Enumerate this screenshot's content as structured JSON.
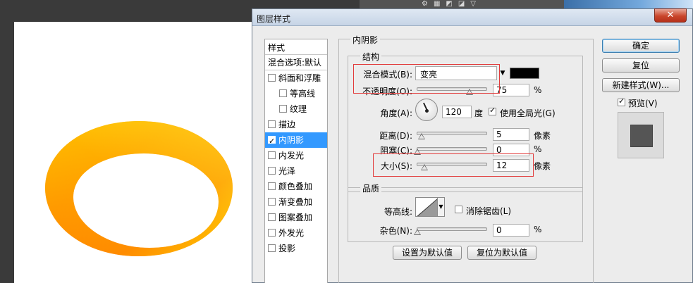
{
  "dialog": {
    "title": "图层样式",
    "close_glyph": "✕"
  },
  "styles_panel": {
    "header": "样式",
    "blend_options": "混合选项:默认",
    "items": [
      {
        "label": "斜面和浮雕",
        "checked": false,
        "indent": false,
        "selected": false
      },
      {
        "label": "等高线",
        "checked": false,
        "indent": true,
        "selected": false
      },
      {
        "label": "纹理",
        "checked": false,
        "indent": true,
        "selected": false
      },
      {
        "label": "描边",
        "checked": false,
        "indent": false,
        "selected": false
      },
      {
        "label": "内阴影",
        "checked": true,
        "indent": false,
        "selected": true
      },
      {
        "label": "内发光",
        "checked": false,
        "indent": false,
        "selected": false
      },
      {
        "label": "光泽",
        "checked": false,
        "indent": false,
        "selected": false
      },
      {
        "label": "颜色叠加",
        "checked": false,
        "indent": false,
        "selected": false
      },
      {
        "label": "渐变叠加",
        "checked": false,
        "indent": false,
        "selected": false
      },
      {
        "label": "图案叠加",
        "checked": false,
        "indent": false,
        "selected": false
      },
      {
        "label": "外发光",
        "checked": false,
        "indent": false,
        "selected": false
      },
      {
        "label": "投影",
        "checked": false,
        "indent": false,
        "selected": false
      }
    ]
  },
  "inner_shadow": {
    "section_title": "内阴影",
    "structure": {
      "title": "结构",
      "blend_mode_label": "混合模式(B):",
      "blend_mode_value": "变亮",
      "color": "#000000",
      "opacity_label": "不透明度(O):",
      "opacity_value": "75",
      "opacity_unit": "%",
      "opacity_fraction": 0.75,
      "angle_label": "角度(A):",
      "angle_value": "120",
      "angle_unit": "度",
      "global_light_label": "使用全局光(G)",
      "global_light_checked": true,
      "distance_label": "距离(D):",
      "distance_value": "5",
      "distance_unit": "像素",
      "choke_label": "阻塞(C):",
      "choke_value": "0",
      "choke_unit": "%",
      "size_label": "大小(S):",
      "size_value": "12",
      "size_unit": "像素"
    },
    "quality": {
      "title": "品质",
      "contour_label": "等高线:",
      "anti_alias_label": "消除锯齿(L)",
      "anti_alias_checked": false,
      "noise_label": "杂色(N):",
      "noise_value": "0",
      "noise_unit": "%"
    },
    "set_default_label": "设置为默认值",
    "reset_default_label": "复位为默认值"
  },
  "buttons": {
    "ok": "确定",
    "reset": "复位",
    "new_style": "新建样式(W)...",
    "preview_label": "预览(V)",
    "preview_checked": true
  },
  "colors": {
    "selection": "#3399ff",
    "highlight_box": "#e23b3b",
    "ring_orange": "#ff8a00",
    "ring_yellow": "#ffee00"
  }
}
